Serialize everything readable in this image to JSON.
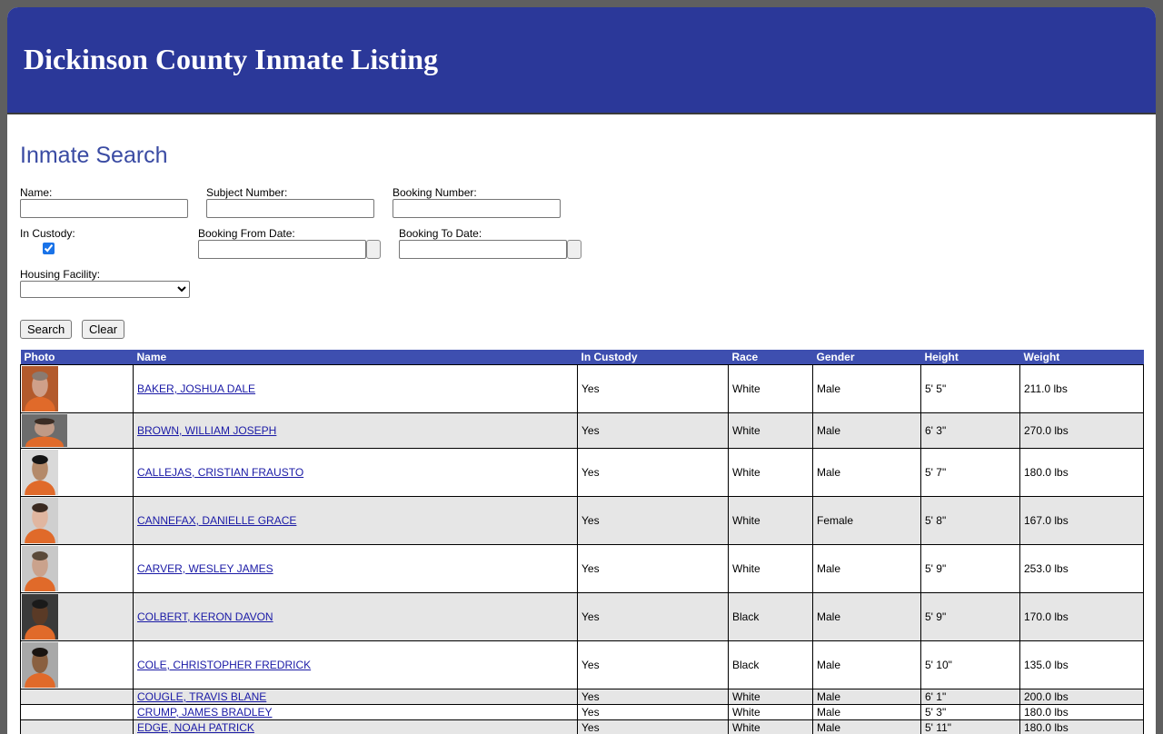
{
  "header": {
    "title": "Dickinson County Inmate Listing"
  },
  "search": {
    "title": "Inmate Search",
    "name_label": "Name:",
    "name_value": "",
    "subject_label": "Subject Number:",
    "subject_value": "",
    "booking_label": "Booking Number:",
    "booking_value": "",
    "custody_label": "In Custody:",
    "custody_checked": true,
    "from_label": "Booking From Date:",
    "from_value": "",
    "to_label": "Booking To Date:",
    "to_value": "",
    "facility_label": "Housing Facility:",
    "facility_value": "",
    "search_button": "Search",
    "clear_button": "Clear"
  },
  "table": {
    "columns": [
      "Photo",
      "Name",
      "In Custody",
      "Race",
      "Gender",
      "Height",
      "Weight"
    ],
    "rows": [
      {
        "name": "BAKER, JOSHUA DALE",
        "custody": "Yes",
        "race": "White",
        "gender": "Male",
        "height": "5' 5\"",
        "weight": "211.0 lbs"
      },
      {
        "name": "BROWN, WILLIAM JOSEPH",
        "custody": "Yes",
        "race": "White",
        "gender": "Male",
        "height": "6' 3\"",
        "weight": "270.0 lbs"
      },
      {
        "name": "CALLEJAS, CRISTIAN FRAUSTO",
        "custody": "Yes",
        "race": "White",
        "gender": "Male",
        "height": "5' 7\"",
        "weight": "180.0 lbs"
      },
      {
        "name": "CANNEFAX, DANIELLE GRACE",
        "custody": "Yes",
        "race": "White",
        "gender": "Female",
        "height": "5' 8\"",
        "weight": "167.0 lbs"
      },
      {
        "name": "CARVER, WESLEY JAMES",
        "custody": "Yes",
        "race": "White",
        "gender": "Male",
        "height": "5' 9\"",
        "weight": "253.0 lbs"
      },
      {
        "name": "COLBERT, KERON DAVON",
        "custody": "Yes",
        "race": "Black",
        "gender": "Male",
        "height": "5' 9\"",
        "weight": "170.0 lbs"
      },
      {
        "name": "COLE, CHRISTOPHER FREDRICK",
        "custody": "Yes",
        "race": "Black",
        "gender": "Male",
        "height": "5' 10\"",
        "weight": "135.0 lbs"
      },
      {
        "name": "COUGLE, TRAVIS BLANE",
        "custody": "Yes",
        "race": "White",
        "gender": "Male",
        "height": "6' 1\"",
        "weight": "200.0 lbs"
      },
      {
        "name": "CRUMP, JAMES BRADLEY",
        "custody": "Yes",
        "race": "White",
        "gender": "Male",
        "height": "5' 3\"",
        "weight": "180.0 lbs"
      },
      {
        "name": "EDGE, NOAH PATRICK",
        "custody": "Yes",
        "race": "White",
        "gender": "Male",
        "height": "5' 11\"",
        "weight": "180.0 lbs"
      }
    ]
  },
  "colors": {
    "banner": "#2b3899",
    "header_row": "#3e4fb0",
    "title_text": "#3a4ba3",
    "link": "#1a1aa6",
    "alt_row": "#e6e6e6"
  }
}
